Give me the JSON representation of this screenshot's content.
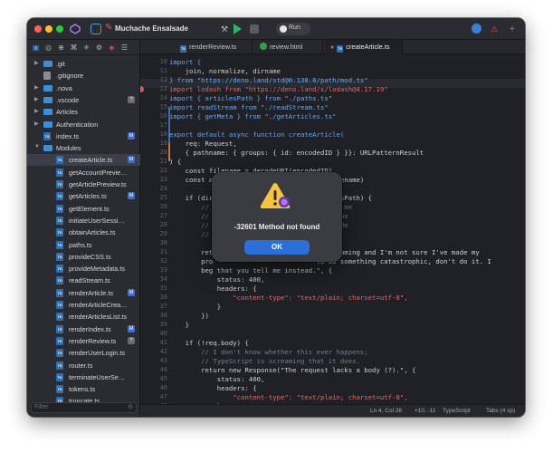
{
  "app": {
    "project_name": "Muchache Ensalsade",
    "run_label": "Run"
  },
  "sidebar": {
    "filter_placeholder": "Filter",
    "items": [
      {
        "label": ".git",
        "type": "folder",
        "collapsed": true
      },
      {
        "label": ".gitignore",
        "type": "git"
      },
      {
        "label": ".nova",
        "type": "folder",
        "collapsed": true
      },
      {
        "label": ".vscode",
        "type": "folder",
        "collapsed": true,
        "badge": "?"
      },
      {
        "label": "Articles",
        "type": "folder",
        "collapsed": true
      },
      {
        "label": "Authentication",
        "type": "folder",
        "collapsed": true
      },
      {
        "label": "index.ts",
        "type": "ts",
        "badge": "M"
      },
      {
        "label": "Modules",
        "type": "folder",
        "collapsed": false
      },
      {
        "label": "createArticle.ts",
        "type": "ts",
        "selected": true,
        "badge": "M"
      },
      {
        "label": "getAccountPreview.ts",
        "type": "ts"
      },
      {
        "label": "getArticlePreview.ts",
        "type": "ts"
      },
      {
        "label": "getArticles.ts",
        "type": "ts",
        "badge": "M"
      },
      {
        "label": "getElement.ts",
        "type": "ts"
      },
      {
        "label": "initiateUserSession.ts",
        "type": "ts"
      },
      {
        "label": "obtainArticles.ts",
        "type": "ts"
      },
      {
        "label": "paths.ts",
        "type": "ts"
      },
      {
        "label": "provideCSS.ts",
        "type": "ts"
      },
      {
        "label": "provideMetadata.ts",
        "type": "ts"
      },
      {
        "label": "readStream.ts",
        "type": "ts"
      },
      {
        "label": "renderArticle.ts",
        "type": "ts",
        "badge": "M"
      },
      {
        "label": "renderArticleCreation...",
        "type": "ts"
      },
      {
        "label": "renderArticlesList.ts",
        "type": "ts"
      },
      {
        "label": "renderIndex.ts",
        "type": "ts",
        "badge": "M"
      },
      {
        "label": "renderReview.ts",
        "type": "ts",
        "badge": "?"
      },
      {
        "label": "renderUserLogin.ts",
        "type": "ts"
      },
      {
        "label": "router.ts",
        "type": "ts"
      },
      {
        "label": "terminateUserSessio...",
        "type": "ts"
      },
      {
        "label": "tokens.ts",
        "type": "ts"
      },
      {
        "label": "truncate.ts",
        "type": "ts"
      }
    ]
  },
  "tabs": [
    {
      "label": "renderReview.ts",
      "icon": "ts"
    },
    {
      "label": "review.html",
      "icon": "html"
    },
    {
      "label": "createArticle.ts",
      "icon": "ts",
      "active": true
    }
  ],
  "editor": {
    "lines": [
      {
        "n": "10",
        "text": "import {"
      },
      {
        "n": "11",
        "text": "    join, normalize, dirname"
      },
      {
        "n": "12",
        "text": "} from \"https://deno.land/std@0.138.0/path/mod.ts\""
      },
      {
        "n": "13",
        "text": "import lodash from \"https://deno.land/x/lodash@4.17.19\""
      },
      {
        "n": "14",
        "text": "import { articlesPath } from \"./paths.ts\""
      },
      {
        "n": "15",
        "text": "import readStream from \"./readStream.ts\""
      },
      {
        "n": "16",
        "text": "import { getMeta } from \"./getArticles.ts\""
      },
      {
        "n": "17",
        "text": ""
      },
      {
        "n": "18",
        "text": "export default async function createArticle("
      },
      {
        "n": "19",
        "text": "    req: Request,"
      },
      {
        "n": "20",
        "text": "    { pathname: { groups: { id: encodedID } }}: URLPatternResult"
      },
      {
        "n": "21",
        "text": ") {"
      },
      {
        "n": "22",
        "text": "    const filename = decodeURI(encodedID)"
      },
      {
        "n": "23",
        "text": "    const a                              ilename)"
      },
      {
        "n": "24",
        "text": ""
      },
      {
        "n": "25",
        "text": "    if (dir                          rticlesPath) {"
      },
      {
        "n": "26",
        "text": "        //                            cares me"
      },
      {
        "n": "27",
        "text": "        //                            ave the"
      },
      {
        "n": "28",
        "text": "        //                            outside"
      },
      {
        "n": "29",
        "text": "        //"
      },
      {
        "n": "30",
        "text": ""
      },
      {
        "n": "31",
        "text": "        ret                           rogramming and I'm not sure I've made my"
      },
      {
        "n": "32",
        "text": "        pro                          to do something catastrophic, don't do it. I"
      },
      {
        "n": "33",
        "text": "        beg that you tell me instead.\", {"
      },
      {
        "n": "34",
        "text": "            status: 400,"
      },
      {
        "n": "35",
        "text": "            headers: {"
      },
      {
        "n": "36",
        "text": "                \"content-type\": \"text/plain; charset=utf-8\","
      },
      {
        "n": "37",
        "text": "            }"
      },
      {
        "n": "38",
        "text": "        })"
      },
      {
        "n": "39",
        "text": "    }"
      },
      {
        "n": "40",
        "text": ""
      },
      {
        "n": "41",
        "text": "    if (!req.body) {"
      },
      {
        "n": "42",
        "text": "        // I don't know whether this ever happens;"
      },
      {
        "n": "43",
        "text": "        // TypeScript is screaming that it does."
      },
      {
        "n": "44",
        "text": "        return new Response(\"The request lacks a body (?).\", {"
      },
      {
        "n": "45",
        "text": "            status: 400,"
      },
      {
        "n": "46",
        "text": "            headers: {"
      },
      {
        "n": "47",
        "text": "                \"content-type\": \"text/plain; charset=utf-8\","
      },
      {
        "n": "48",
        "text": "            }"
      },
      {
        "n": "49",
        "text": "        })"
      }
    ]
  },
  "statusbar": {
    "position": "Ln 4, Col 26",
    "diff": "+10, -11",
    "language": "TypeScript",
    "indent": "Tabs (4 sp)"
  },
  "dialog": {
    "message": "-32601 Method not found",
    "ok_label": "OK"
  },
  "colors": {
    "accent": "#2d6fd8",
    "error": "#e0574c",
    "run_green": "#2fb35d"
  }
}
